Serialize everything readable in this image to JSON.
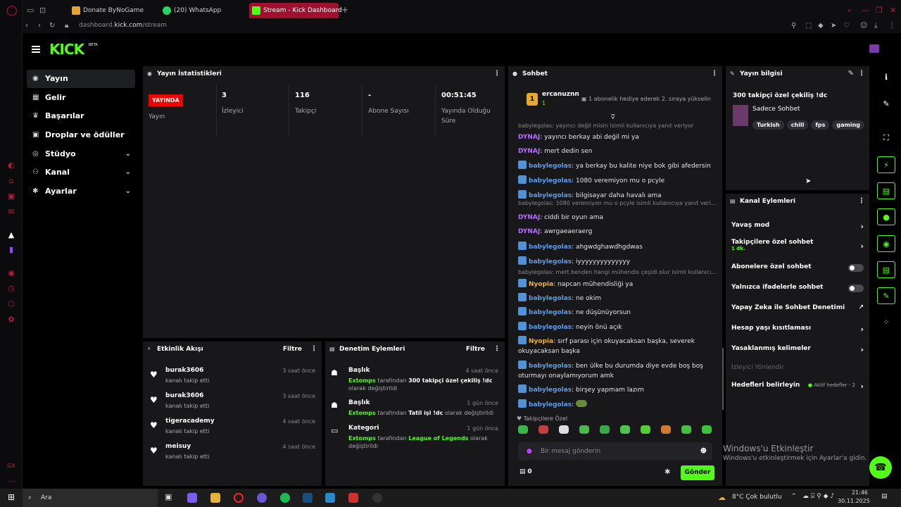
{
  "browser": {
    "tabs": [
      {
        "label": "Donate ByNoGame"
      },
      {
        "label": "(20) WhatsApp"
      },
      {
        "label": "Stream - Kick Dashboard"
      }
    ],
    "url_prefix": "dashboard.",
    "url_domain": "kick.com",
    "url_path": "/stream"
  },
  "header": {
    "logo": "KICK",
    "beta": "BETA"
  },
  "sidebar": {
    "items": [
      {
        "label": "Yayın",
        "icon": "broadcast-icon"
      },
      {
        "label": "Gelir",
        "icon": "revenue-icon"
      },
      {
        "label": "Başarılar",
        "icon": "trophy-icon"
      },
      {
        "label": "Droplar ve ödüller",
        "icon": "gift-icon"
      },
      {
        "label": "Stüdyo",
        "icon": "studio-icon"
      },
      {
        "label": "Kanal",
        "icon": "channel-icon"
      },
      {
        "label": "Ayarlar",
        "icon": "settings-icon"
      }
    ]
  },
  "stats": {
    "title": "Yayın İstatistikleri",
    "live_badge": "YAYINDA",
    "items": [
      {
        "value": "",
        "label": "Yayın"
      },
      {
        "value": "3",
        "label": "İzleyici"
      },
      {
        "value": "116",
        "label": "Takipçi"
      },
      {
        "value": "-",
        "label": "Abone Sayısı"
      },
      {
        "value": "00:51:45",
        "label": "Yayında Olduğu Süre"
      }
    ]
  },
  "events": {
    "title": "Etkinlik Akışı",
    "filter": "Filtre",
    "items": [
      {
        "name": "burak3606",
        "sub": "kanalı takip etti",
        "time": "3 saat önce"
      },
      {
        "name": "burak3606",
        "sub": "kanalı takip etti",
        "time": "3 saat önce"
      },
      {
        "name": "tigeracademy",
        "sub": "kanalı takip etti",
        "time": "4 saat önce"
      },
      {
        "name": "meisuy",
        "sub": "kanalı takip etti",
        "time": "4 saat önce"
      }
    ]
  },
  "moderation": {
    "title": "Denetim Eylemleri",
    "filter": "Filtre",
    "items": [
      {
        "head": "Başlık",
        "time": "4 saat önce",
        "user": "Extomps",
        "mid": " tarafından ",
        "target": "300 takipçi özel çekiliş !dc",
        "end": " olarak değiştirildi"
      },
      {
        "head": "Başlık",
        "time": "1 gün önce",
        "user": "Extomps",
        "mid": " tarafından ",
        "target": "Tatil işi !dc",
        "end": " olarak değiştirildi"
      },
      {
        "head": "Kategori",
        "time": "1 gün önce",
        "user": "Extomps",
        "mid": " tarafından ",
        "target": "League of Legends",
        "end": "  olarak değiştirildi"
      }
    ]
  },
  "chat": {
    "title": "Sohbet",
    "pinned_user": "ercanuznn",
    "pinned_count": "1",
    "pinned_rank": "1",
    "pinned_text": "1 abonelik hediye ederek 2. sıraya yükselin",
    "messages": [
      {
        "reply": "babylegolas: yayıncı değil misin isimli kullanıcıya yanıt veriyor",
        "user": "DYNAJ",
        "color": "#b86cff",
        "badge": false,
        "text": ": yayıncı berkay abi değil mi ya"
      },
      {
        "user": "DYNAJ",
        "color": "#b86cff",
        "badge": false,
        "text": ": mert dedin sen"
      },
      {
        "user": "babylegolas",
        "color": "#5e9ce8",
        "badge": true,
        "text": ": ya berkay bu kalite niye bok gibi afedersin"
      },
      {
        "user": "babylegolas",
        "color": "#5e9ce8",
        "badge": true,
        "text": ": 1080 veremiyon mu o pcyle"
      },
      {
        "user": "babylegolas",
        "color": "#5e9ce8",
        "badge": true,
        "text": ": bilgisayar daha havalı ama"
      },
      {
        "reply": "babylegolas: 1080 veremiyon mu o pcyle isimli kullanıcıya yanıt veri...",
        "user": "DYNAJ",
        "color": "#b86cff",
        "badge": false,
        "text": ": ciddi bir oyun ama"
      },
      {
        "user": "DYNAJ",
        "color": "#b86cff",
        "badge": false,
        "text": ": awrgaeaeraerg"
      },
      {
        "user": "babylegolas",
        "color": "#5e9ce8",
        "badge": true,
        "text": ": ahgwdghawdhgdwas"
      },
      {
        "user": "babylegolas",
        "color": "#5e9ce8",
        "badge": true,
        "text": ": iyyyyyyyyyyyyyy"
      },
      {
        "reply": "babylegolas: mert benden hangi mühendis çeşidi olur isimli kullanıcı...",
        "user": "Nyopia",
        "color": "#f0b03a",
        "badge": true,
        "text": ": napcan mühendisliği ya"
      },
      {
        "user": "babylegolas",
        "color": "#5e9ce8",
        "badge": true,
        "text": ": ne okim"
      },
      {
        "user": "babylegolas",
        "color": "#5e9ce8",
        "badge": true,
        "text": ": ne düşünüyorsun"
      },
      {
        "user": "babylegolas",
        "color": "#5e9ce8",
        "badge": true,
        "text": ": neyin önü açık"
      },
      {
        "user": "Nyopia",
        "color": "#f0b03a",
        "badge": true,
        "text": ": sırf parası için okuyacaksan başka, severek okuyacaksan başka"
      },
      {
        "user": "babylegolas",
        "color": "#5e9ce8",
        "badge": true,
        "text": ": ben ülke bu durumda diye evde boş boş oturmayı onaylamıyorum amk"
      },
      {
        "user": "babylegolas",
        "color": "#5e9ce8",
        "badge": true,
        "text": ": birşey yapmam lazım"
      },
      {
        "user": "babylegolas",
        "color": "#5e9ce8",
        "badge": true,
        "text": ": "
      }
    ],
    "emotes_label": "Takipçilere Özel",
    "input_placeholder": "Bir mesaj gönderin",
    "points": "0",
    "send_label": "Gönder"
  },
  "streaminfo": {
    "title": "Yayın bilgisi",
    "stream_title": "300 takipçi özel çekiliş !dc",
    "category": "Sadece Sohbet",
    "tags": [
      "Turkish",
      "chill",
      "fps",
      "gaming"
    ]
  },
  "channel_actions": {
    "title": "Kanal Eylemleri",
    "items": [
      {
        "label": "Yavaş mod",
        "sub": "",
        "kind": "chevron"
      },
      {
        "label": "Takipçilere özel sohbet",
        "sub": "1 dk.",
        "kind": "chevron"
      },
      {
        "label": "Abonelere özel sohbet",
        "sub": "",
        "kind": "toggle"
      },
      {
        "label": "Yalnızca ifadelerle sohbet",
        "sub": "",
        "kind": "toggle"
      },
      {
        "label": "Yapay Zeka ile Sohbet Denetimi",
        "sub": "",
        "kind": "external"
      },
      {
        "label": "Hesap yaşı kısıtlaması",
        "sub": "",
        "kind": "chevron"
      },
      {
        "label": "Yasaklanmış kelimeler",
        "sub": "",
        "kind": "chevron"
      },
      {
        "label": "İzleyici Yönlendir",
        "sub": "",
        "kind": "disabled"
      },
      {
        "label": "Hedefleri belirleyin",
        "sub": "Aktif hedefler - 2",
        "kind": "chevron"
      }
    ]
  },
  "watermark": {
    "line1": "Windows'u Etkinleştir",
    "line2": "Windows'u etkinleştirmek için Ayarlar'a gidin."
  },
  "taskbar": {
    "search": "Ara",
    "weather": "8°C  Çok bulutlu",
    "time": "21:46",
    "date": "30.11.2025"
  },
  "colors": {
    "accent": "#53fc18",
    "live": "#eb0400",
    "panel": "#18181b"
  }
}
